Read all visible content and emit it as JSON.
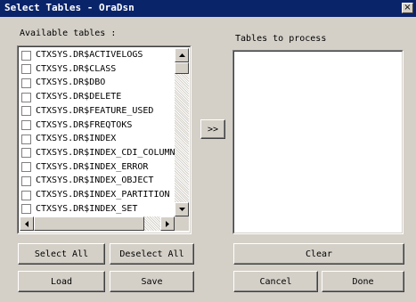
{
  "window": {
    "title": "Select Tables - OraDsn",
    "close_glyph": "×"
  },
  "available": {
    "label": "Available tables :",
    "items": [
      "CTXSYS.DR$ACTIVELOGS",
      "CTXSYS.DR$CLASS",
      "CTXSYS.DR$DBO",
      "CTXSYS.DR$DELETE",
      "CTXSYS.DR$FEATURE_USED",
      "CTXSYS.DR$FREQTOKS",
      "CTXSYS.DR$INDEX",
      "CTXSYS.DR$INDEX_CDI_COLUMN",
      "CTXSYS.DR$INDEX_ERROR",
      "CTXSYS.DR$INDEX_OBJECT",
      "CTXSYS.DR$INDEX_PARTITION",
      "CTXSYS.DR$INDEX_SET"
    ]
  },
  "process": {
    "label": "Tables to process",
    "items": []
  },
  "buttons": {
    "move": ">>",
    "select_all": "Select All",
    "deselect_all": "Deselect All",
    "load": "Load",
    "save": "Save",
    "clear": "Clear",
    "cancel": "Cancel",
    "done": "Done"
  },
  "icons": {
    "close": "close-icon",
    "scroll_up": "arrow-up-icon",
    "scroll_down": "arrow-down-icon",
    "scroll_left": "arrow-left-icon",
    "scroll_right": "arrow-right-icon"
  },
  "colors": {
    "titlebar": "#0a246a",
    "face": "#d4d0c8"
  }
}
